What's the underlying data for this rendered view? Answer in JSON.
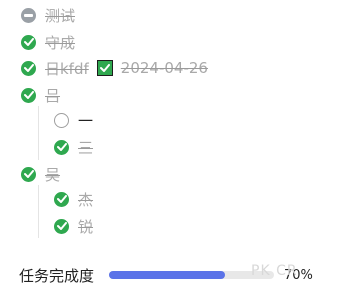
{
  "tasks": {
    "items": [
      {
        "label": "测试",
        "status": "cancelled"
      },
      {
        "label": "守成",
        "status": "done"
      },
      {
        "label": "日kfdf",
        "status": "done",
        "emoji": "check-mark-button-icon",
        "date": "2024-04-26"
      },
      {
        "label": "吕",
        "status": "done"
      },
      {
        "label": "一",
        "status": "todo"
      },
      {
        "label": "三",
        "status": "done"
      },
      {
        "label": "吴",
        "status": "done"
      },
      {
        "label": "杰",
        "status": "done"
      },
      {
        "label": "锐",
        "status": "done"
      }
    ]
  },
  "progress": {
    "label": "任务完成度",
    "value": "70%",
    "fraction": 0.7
  },
  "watermark": {
    "text": "PK CR"
  },
  "colors": {
    "done": "#2fa84f",
    "cancelled": "#9aa0a6",
    "progress": "#5b73e8"
  }
}
